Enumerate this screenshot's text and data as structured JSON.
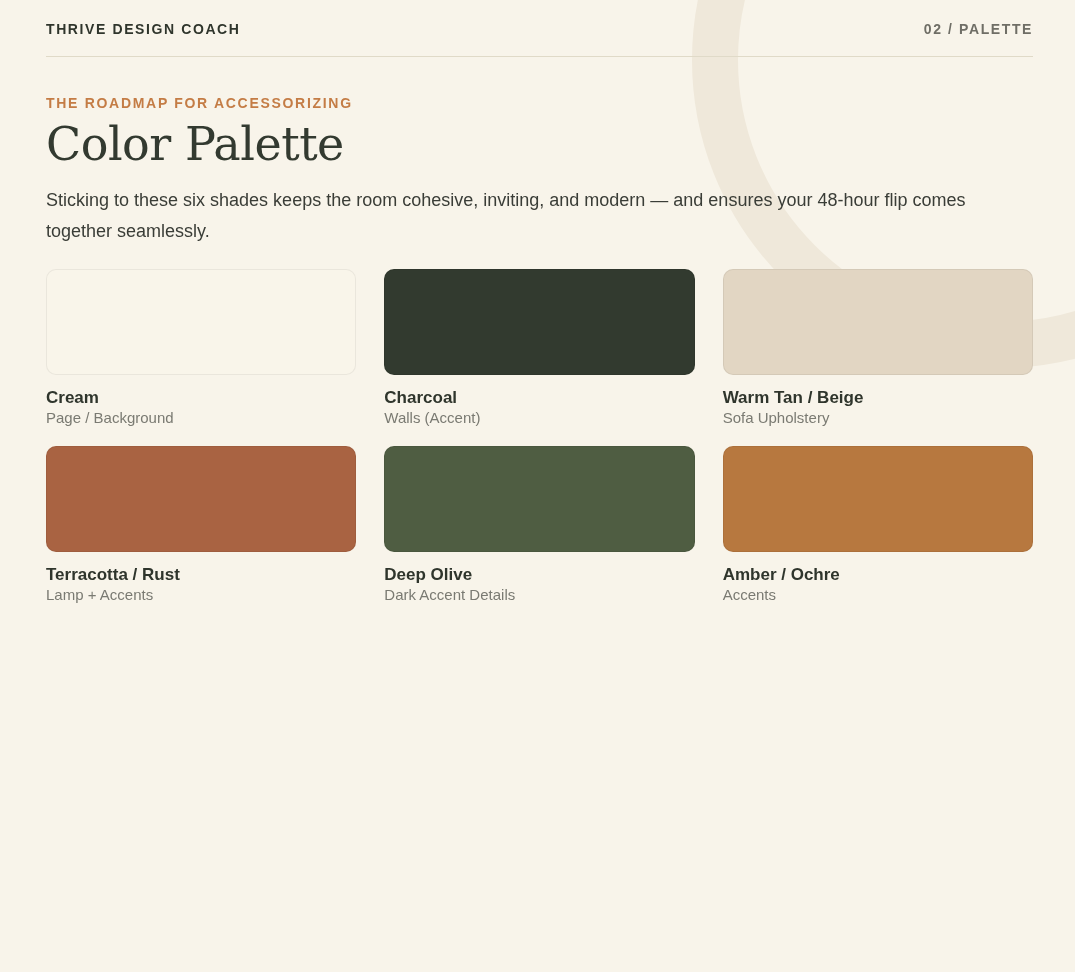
{
  "header": {
    "brand": "THRIVE DESIGN COACH",
    "section": "02 / PALETTE"
  },
  "eyebrow": "THE ROADMAP FOR ACCESSORIZING",
  "title": "Color Palette",
  "intro": "Sticking to these six shades keeps the room cohesive, inviting, and modern — and ensures your 48-hour flip comes together seamlessly.",
  "swatches": [
    {
      "name": "Cream",
      "use": "Page / Background",
      "color": "#f9f5ea"
    },
    {
      "name": "Charcoal",
      "use": "Walls (Accent)",
      "color": "#323a2f"
    },
    {
      "name": "Warm Tan / Beige",
      "use": "Sofa Upholstery",
      "color": "#e2d6c3"
    },
    {
      "name": "Terracotta / Rust",
      "use": "Lamp + Accents",
      "color": "#a96342"
    },
    {
      "name": "Deep Olive",
      "use": "Dark Accent Details",
      "color": "#4f5d42"
    },
    {
      "name": "Amber / Ochre",
      "use": "Accents",
      "color": "#b7783f"
    }
  ]
}
